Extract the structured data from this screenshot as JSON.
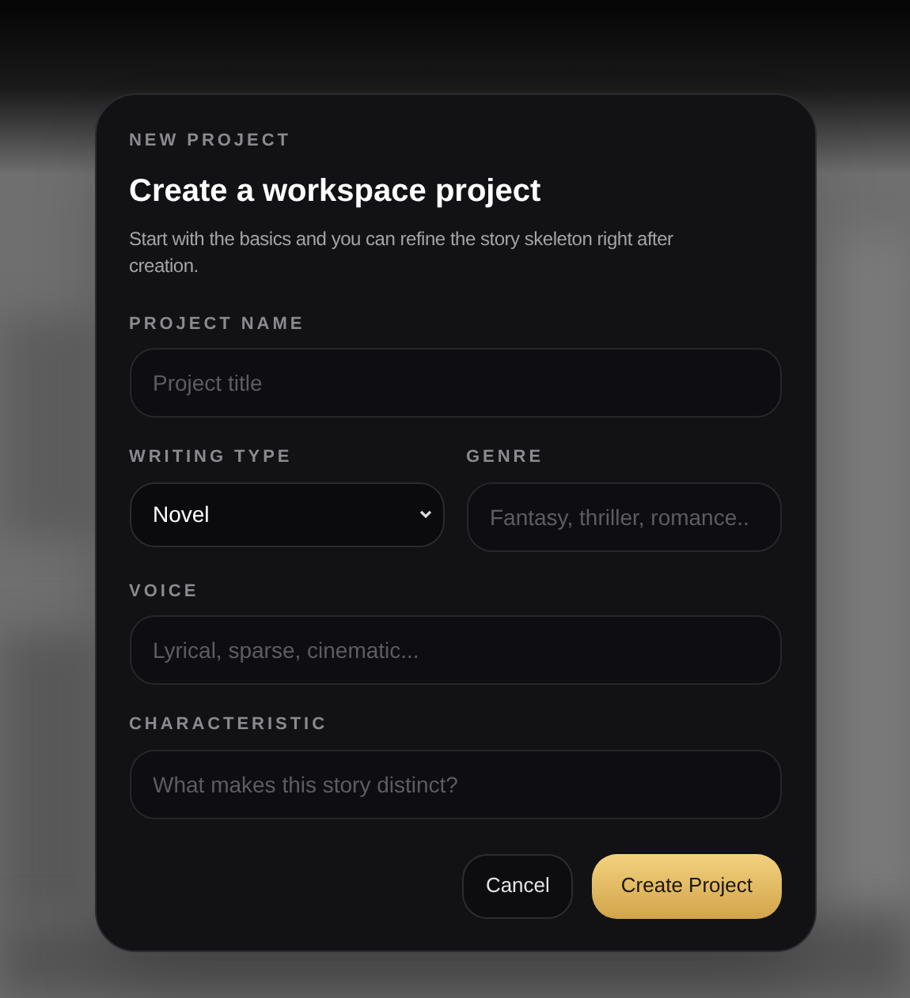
{
  "dialog": {
    "eyebrow": "NEW PROJECT",
    "title": "Create a workspace project",
    "description": "Start with the basics and you can refine the story skeleton right after creation.",
    "rows": [
      [
        {
          "kind": "text",
          "label": "PROJECT NAME",
          "placeholder": "Project title"
        }
      ],
      [
        {
          "kind": "select",
          "label": "WRITING TYPE",
          "value": "Novel"
        },
        {
          "kind": "text",
          "label": "GENRE",
          "placeholder": "Fantasy, thriller, romance.."
        }
      ],
      [
        {
          "kind": "text",
          "label": "VOICE",
          "placeholder": "Lyrical, sparse, cinematic..."
        }
      ],
      [
        {
          "kind": "text",
          "label": "CHARACTERISTIC",
          "placeholder": "What makes this story distinct?"
        }
      ]
    ],
    "buttons": [
      {
        "label": "Cancel",
        "kind": "secondary"
      },
      {
        "label": "Create Project",
        "kind": "primary"
      }
    ]
  }
}
